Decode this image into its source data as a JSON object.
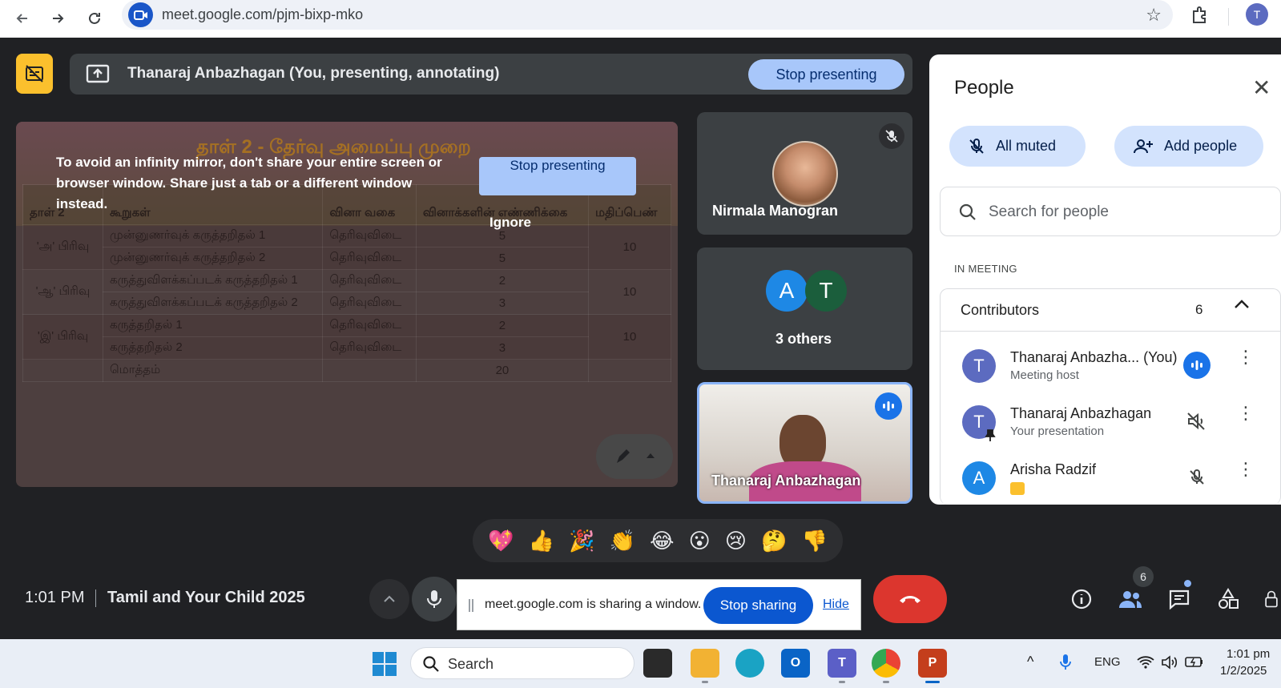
{
  "browser": {
    "url": "meet.google.com/pjm-bixp-mko",
    "profile_initial": "T"
  },
  "presenting_bar": {
    "text": "Thanaraj Anbazhagan (You, presenting, annotating)",
    "stop_label": "Stop presenting"
  },
  "slide": {
    "title": "தாள் 2 - தேர்வு அமைப்பு முறை",
    "headers": [
      "தாள் 2",
      "கூறுகள்",
      "வினா வகை",
      "வினாக்களின் எண்ணிக்கை",
      "மதிப்பெண்"
    ],
    "sections": [
      {
        "label": "'அ' பிரிவு",
        "total": "10",
        "rows": [
          {
            "item": "முன்னுணர்வுக் கருத்தறிதல் 1",
            "type": "தெரிவுவிடை",
            "count": "5"
          },
          {
            "item": "முன்னுணர்வுக் கருத்தறிதல் 2",
            "type": "தெரிவுவிடை",
            "count": "5"
          }
        ]
      },
      {
        "label": "'ஆ' பிரிவு",
        "total": "10",
        "rows": [
          {
            "item": "கருத்துவிளக்கப்படக் கருத்தறிதல் 1",
            "type": "தெரிவுவிடை",
            "count": "2"
          },
          {
            "item": "கருத்துவிளக்கப்படக் கருத்தறிதல் 2",
            "type": "தெரிவுவிடை",
            "count": "3"
          }
        ]
      },
      {
        "label": "'இ' பிரிவு",
        "total": "10",
        "rows": [
          {
            "item": "கருத்தறிதல் 1",
            "type": "தெரிவுவிடை",
            "count": "2"
          },
          {
            "item": "கருத்தறிதல் 2",
            "type": "தெரிவுவிடை",
            "count": "3"
          }
        ]
      }
    ],
    "total_label": "மொத்தம்",
    "total_count": "20"
  },
  "mirror_warning": {
    "message": "To avoid an infinity mirror, don't share your entire screen or browser window. Share just a tab or a different window instead.",
    "stop_label": "Stop presenting",
    "ignore_label": "Ignore"
  },
  "tiles": {
    "nirmala_name": "Nirmala Manogran",
    "others_avatars": [
      {
        "initial": "A",
        "color": "#1e88e5"
      },
      {
        "initial": "T",
        "color": "#1b5e3c"
      }
    ],
    "others_label": "3 others",
    "self_name": "Thanaraj Anbazhagan"
  },
  "people_panel": {
    "title": "People",
    "all_muted_label": "All muted",
    "add_people_label": "Add people",
    "search_placeholder": "Search for people",
    "section_label": "IN MEETING",
    "contributors_label": "Contributors",
    "contributors_count": "6",
    "participants": [
      {
        "initial": "T",
        "color": "#5c6bc0",
        "name": "Thanaraj Anbazha...",
        "suffix": "(You)",
        "sub": "Meeting host",
        "status": "speaking"
      },
      {
        "initial": "T",
        "color": "#5c6bc0",
        "name": "Thanaraj Anbazhagan",
        "suffix": "",
        "sub": "Your presentation",
        "status": "muted-audio"
      },
      {
        "initial": "A",
        "color": "#1e88e5",
        "name": "Arisha Radzif",
        "suffix": "",
        "sub": "",
        "status": "mic-off"
      }
    ]
  },
  "reactions": [
    "💖",
    "👍",
    "🎉",
    "👏",
    "😂",
    "😮",
    "😢",
    "🤔",
    "👎"
  ],
  "bottom": {
    "time": "1:01 PM",
    "meeting_title": "Tamil and Your Child 2025",
    "share_message": "meet.google.com is sharing a window.",
    "stop_sharing_label": "Stop sharing",
    "hide_label": "Hide",
    "people_count": "6"
  },
  "taskbar": {
    "search_placeholder": "Search",
    "language": "ENG",
    "clock_time": "1:01 pm",
    "clock_date": "1/2/2025"
  },
  "colors": {
    "accent": "#a8c7fa",
    "leave_red": "#dc362e",
    "meet_bg": "#202124",
    "primary_blue": "#0b57d0"
  }
}
